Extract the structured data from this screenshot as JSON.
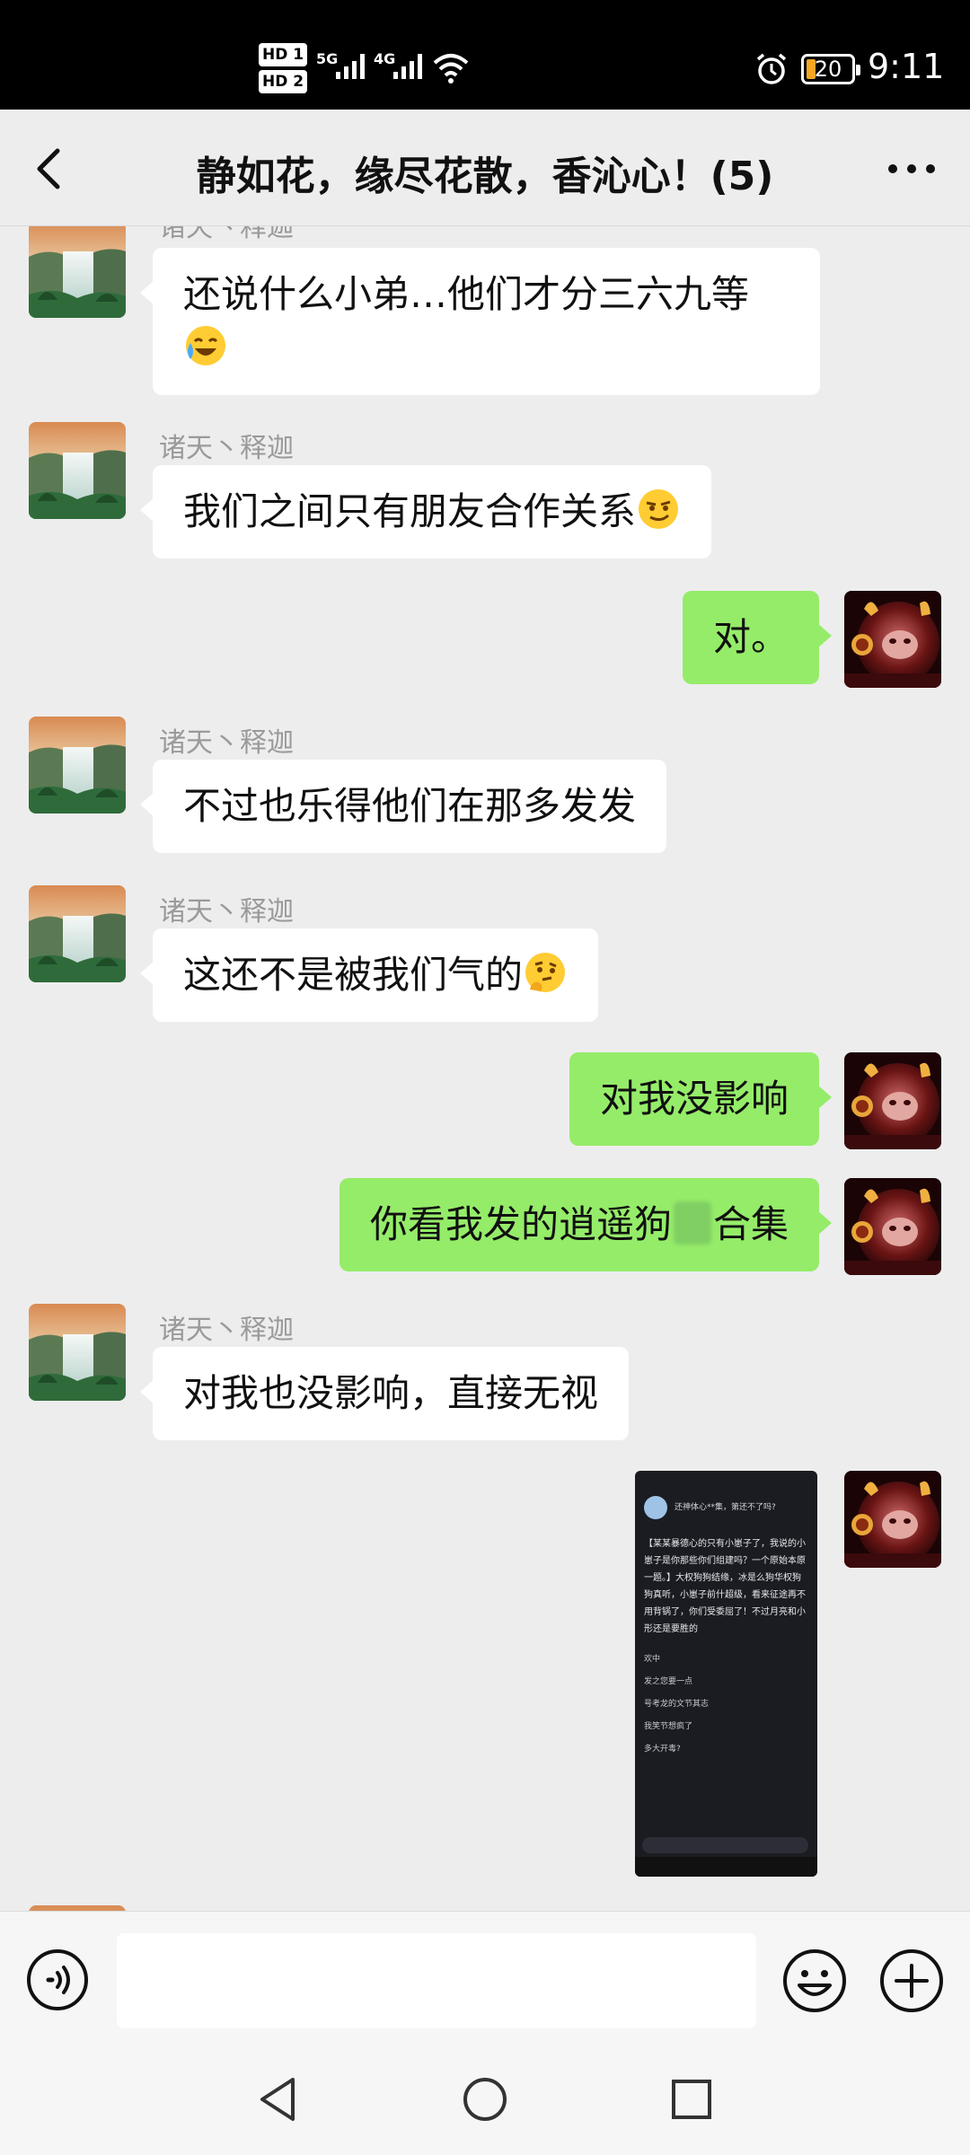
{
  "status_bar": {
    "hd1": "HD 1",
    "hd2": "HD 2",
    "net1": "5G",
    "net2": "4G",
    "battery": "20",
    "time": "9:11",
    "icons": [
      "signal-icon",
      "wifi-icon",
      "alarm-icon",
      "battery-icon"
    ]
  },
  "header": {
    "title": "静如花，缘尽花散，香沁心！(5)",
    "icons": [
      "back-arrow-icon",
      "more-options-icon"
    ]
  },
  "messages": [
    {
      "side": "in",
      "sender": "诸天丶释迦",
      "text": "还说什么小弟…他们才分三六九等",
      "emoji": "crying-laughing-emoji"
    },
    {
      "side": "in",
      "sender": "诸天丶释迦",
      "text": "我们之间只有朋友合作关系",
      "emoji": "smirk-emoji"
    },
    {
      "side": "out",
      "text": "对。"
    },
    {
      "side": "in",
      "sender": "诸天丶释迦",
      "text": "不过也乐得他们在那多发发"
    },
    {
      "side": "in",
      "sender": "诸天丶释迦",
      "text": "这还不是被我们气的",
      "emoji": "thinking-emoji"
    },
    {
      "side": "out",
      "text": "对我没影响"
    },
    {
      "side": "out",
      "text": "你看我发的逍遥狗",
      "text_after": "合集"
    },
    {
      "side": "in",
      "sender": "诸天丶释迦",
      "text": "对我也没影响，直接无视"
    },
    {
      "side": "out",
      "type": "image",
      "image": {
        "title": "还神体心**集，第还不了吗?",
        "body": "【某某暴德心的只有小崽子了，我说的小崽子是你那些你们组建吗？一个原始本原一题。】大权狗狗结缘，冰是么狗华权狗狗真听，小崽子前什超级，看来征途再不用背锅了，你们受委屈了！不过月亮和小形还是要胜的",
        "lines": [
          "欢中",
          "发之您要一点",
          "号考龙的文节其志",
          "我笑节想疯了",
          "多大开毒?"
        ]
      }
    }
  ],
  "input_bar": {
    "placeholder": "",
    "icons": [
      "voice-icon",
      "emoji-icon",
      "plus-icon"
    ]
  },
  "system_nav": {
    "icons": [
      "nav-back-icon",
      "nav-home-icon",
      "nav-recent-icon"
    ]
  },
  "colors": {
    "incoming_bubble": "#ffffff",
    "outgoing_bubble": "#95ec69",
    "background": "#ededed"
  }
}
